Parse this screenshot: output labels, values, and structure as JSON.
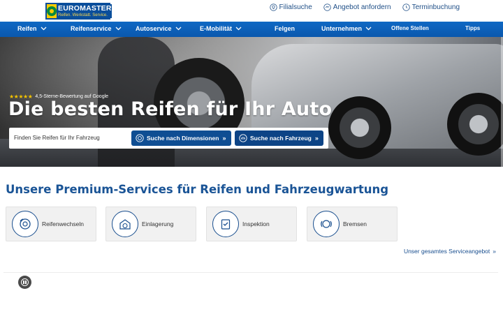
{
  "brand": {
    "name": "EUROMASTER",
    "tagline": "Reifen. Werkstatt. Service.",
    "colors": {
      "primary": "#0a4e9b",
      "yellow": "#ffcc00",
      "green": "#0a8a3c"
    }
  },
  "toplinks": [
    {
      "label": "Filialsuche",
      "icon": "location-pin-icon"
    },
    {
      "label": "Angebot anfordern",
      "icon": "offer-icon"
    },
    {
      "label": "Terminbuchung",
      "icon": "clock-icon"
    }
  ],
  "nav": [
    {
      "label": "Reifen",
      "has_dropdown": true
    },
    {
      "label": "Reifenservice",
      "has_dropdown": true
    },
    {
      "label": "Autoservice",
      "has_dropdown": true
    },
    {
      "label": "E-Mobilität",
      "has_dropdown": true
    },
    {
      "label": "Felgen",
      "has_dropdown": false
    },
    {
      "label": "Unternehmen",
      "has_dropdown": true
    },
    {
      "label": "Offene Stellen",
      "has_dropdown": false
    },
    {
      "label": "Tipps",
      "has_dropdown": false
    }
  ],
  "hero": {
    "rating_stars": 5,
    "rating_text": "4,5-Sterne-Bewertung auf Google",
    "title": "Die besten Reifen für Ihr Auto",
    "search_label": "Finden Sie Reifen für Ihr Fahrzeug",
    "search_by_dimensions": "Suche nach Dimensionen",
    "search_by_vehicle": "Suche nach Fahrzeug"
  },
  "services": {
    "title": "Unsere Premium-Services für Reifen und Fahrzeugwartung",
    "items": [
      {
        "label": "Reifenwechseln",
        "icon": "tire-change-icon"
      },
      {
        "label": "Einlagerung",
        "icon": "storage-icon"
      },
      {
        "label": "Inspektion",
        "icon": "inspection-icon"
      },
      {
        "label": "Bremsen",
        "icon": "brakes-icon"
      }
    ],
    "all_link": "Unser gesamtes Serviceangebot"
  }
}
